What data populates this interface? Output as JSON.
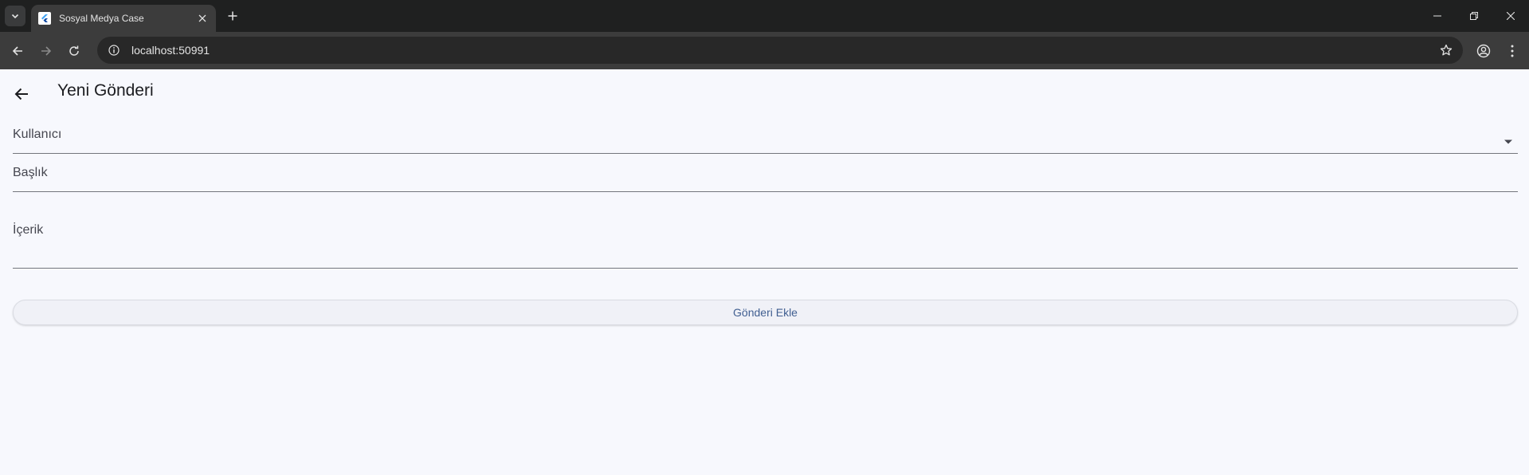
{
  "browser": {
    "tab": {
      "title": "Sosyal Medya Case"
    },
    "address_bar": {
      "url": "localhost:50991"
    }
  },
  "app": {
    "page_title": "Yeni Gönderi",
    "form": {
      "user_field_label": "Kullanıcı",
      "title_field_label": "Başlık",
      "content_field_label": "İçerik",
      "submit_label": "Gönderi Ekle"
    }
  },
  "colors": {
    "chrome_dark": "#1f2020",
    "toolbar": "#3c3c3c",
    "page_background": "#f7f8fd",
    "button_text": "#415f91"
  }
}
